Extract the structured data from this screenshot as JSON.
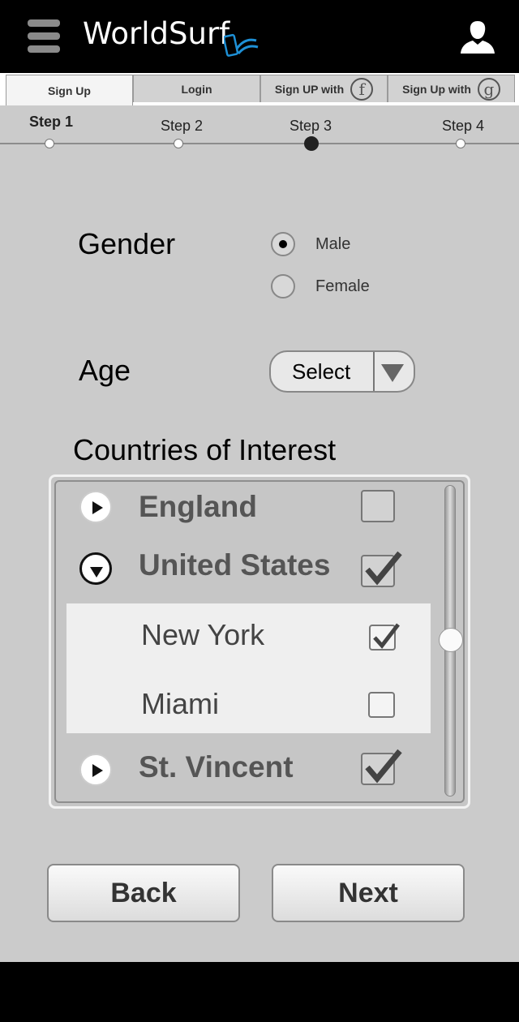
{
  "header": {
    "app_title": "WorldSurf"
  },
  "tabs": [
    {
      "label": "Sign Up",
      "active": true
    },
    {
      "label": "Login",
      "active": false
    },
    {
      "label": "Sign UP with",
      "social_icon": "facebook-icon",
      "glyph": "f"
    },
    {
      "label": "Sign Up with",
      "social_icon": "google-icon",
      "glyph": "g"
    }
  ],
  "steps": [
    {
      "label": "Step 1"
    },
    {
      "label": "Step 2"
    },
    {
      "label": "Step 3"
    },
    {
      "label": "Step 4"
    }
  ],
  "form": {
    "gender_label": "Gender",
    "gender_options": [
      {
        "label": "Male",
        "selected": true
      },
      {
        "label": "Female",
        "selected": false
      }
    ],
    "age_label": "Age",
    "age_value": "Select",
    "countries_label": "Countries of Interest",
    "countries": [
      {
        "name": "England",
        "expanded": false,
        "checked": false
      },
      {
        "name": "United States",
        "expanded": true,
        "checked": true,
        "cities": [
          {
            "name": "New York",
            "checked": true
          },
          {
            "name": "Miami",
            "checked": false
          }
        ]
      },
      {
        "name": "St. Vincent",
        "expanded": false,
        "checked": true
      }
    ]
  },
  "buttons": {
    "back": "Back",
    "next": "Next"
  },
  "colors": {
    "panel_bg": "#cbcbcb",
    "header_bg": "#000000",
    "logo_accent": "#1e90d6"
  }
}
